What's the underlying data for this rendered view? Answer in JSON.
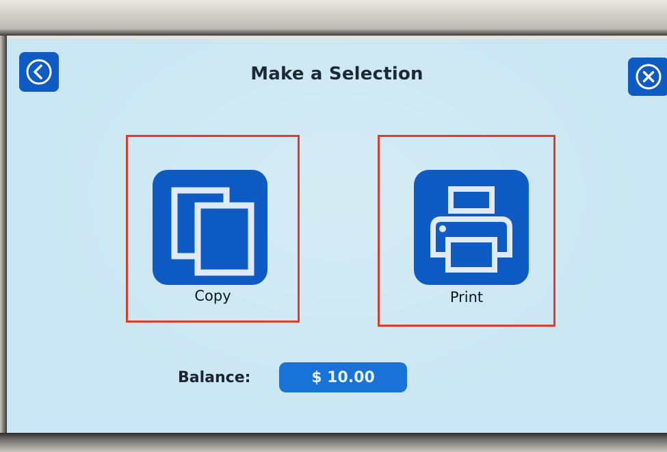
{
  "header": {
    "title": "Make a Selection",
    "back_icon": "chevron-left-circle-icon",
    "close_icon": "close-circle-icon"
  },
  "options": [
    {
      "label": "Copy",
      "icon": "copy-icon"
    },
    {
      "label": "Print",
      "icon": "printer-icon"
    }
  ],
  "balance": {
    "label": "Balance:",
    "value": "$ 10.00"
  },
  "colors": {
    "screen_bg": "#c9e6f2",
    "accent_blue": "#0f5bc4",
    "pill_blue": "#1872d8",
    "highlight_red": "#e03a2a"
  }
}
